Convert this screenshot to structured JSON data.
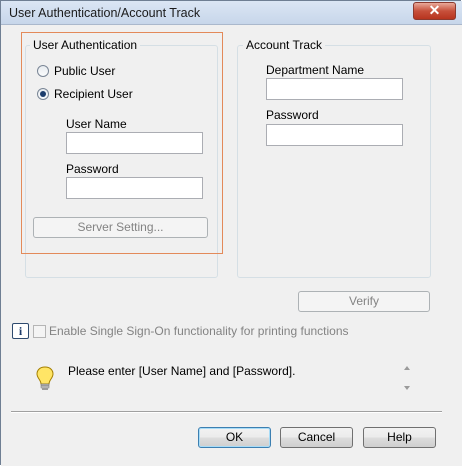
{
  "window": {
    "title": "User Authentication/Account Track",
    "close_label": "✕"
  },
  "user_auth": {
    "title": "User Authentication",
    "public_user": "Public User",
    "recipient_user": "Recipient User",
    "selected": "Recipient User",
    "user_name_label": "User Name",
    "user_name_value": "",
    "password_label": "Password",
    "password_value": "",
    "server_setting": "Server Setting..."
  },
  "account_track": {
    "title": "Account Track",
    "department_label": "Department Name",
    "department_value": "",
    "password_label": "Password",
    "password_value": ""
  },
  "verify": "Verify",
  "info_icon_label": "i",
  "sso_label": "Enable Single Sign-On functionality for printing functions",
  "hint": "Please enter [User Name] and [Password].",
  "buttons": {
    "ok": "OK",
    "cancel": "Cancel",
    "help": "Help"
  }
}
